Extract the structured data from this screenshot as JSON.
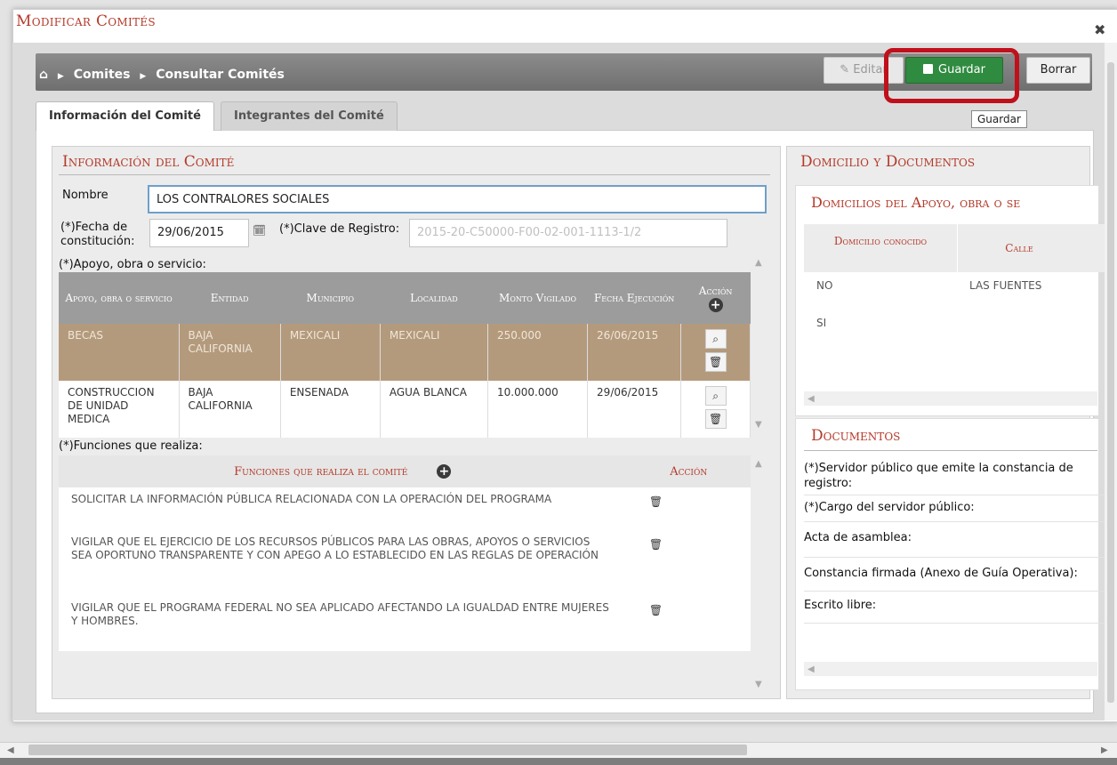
{
  "dialog": {
    "title": "Modificar Comités",
    "close_icon": "✖"
  },
  "breadcrumb": {
    "home_icon": "⌂",
    "items": [
      "Comites",
      "Consultar Comités"
    ]
  },
  "toolbar": {
    "editar": "Editar",
    "guardar": "Guardar",
    "borrar": "Borrar",
    "tooltip": "Guardar"
  },
  "tabs": [
    "Información del Comité",
    "Integrantes del Comité"
  ],
  "info": {
    "title": "Información del Comité",
    "nombre_label": "Nombre",
    "nombre_value": "LOS CONTRALORES SOCIALES",
    "fecha_label_1": "(*)Fecha de",
    "fecha_label_2": "constitución:",
    "fecha_value": "29/06/2015",
    "clave_label": "(*)Clave de Registro:",
    "clave_value": "2015-20-C50000-F00-02-001-1113-1/2",
    "apoyo_label": "(*)Apoyo, obra o servicio:",
    "funciones_label": "(*)Funciones que realiza:"
  },
  "apoyo_table": {
    "headers": [
      "Apoyo, obra o servicio",
      "Entidad",
      "Municipio",
      "Localidad",
      "Monto Vigilado",
      "Fecha Ejecución",
      "Acción"
    ],
    "rows": [
      [
        "BECAS",
        "BAJA CALIFORNIA",
        "MEXICALI",
        "MEXICALI",
        "250.000",
        "26/06/2015"
      ],
      [
        "CONSTRUCCION DE UNIDAD MEDICA",
        "BAJA CALIFORNIA",
        "ENSENADA",
        "AGUA BLANCA",
        "10.000.000",
        "29/06/2015"
      ]
    ]
  },
  "funciones_table": {
    "headers": [
      "Funciones que realiza el comité",
      "Acción"
    ],
    "rows": [
      "SOLICITAR LA INFORMACIÓN PÚBLICA RELACIONADA CON LA OPERACIÓN DEL PROGRAMA",
      "VIGILAR QUE EL EJERCICIO DE LOS RECURSOS PÚBLICOS PARA LAS OBRAS, APOYOS O SERVICIOS SEA OPORTUNO TRANSPARENTE Y CON APEGO A LO ESTABLECIDO EN LAS REGLAS DE OPERACIÓN",
      "VIGILAR QUE EL PROGRAMA FEDERAL NO SEA APLICADO AFECTANDO LA IGUALDAD ENTRE MUJERES Y HOMBRES."
    ]
  },
  "domicilio": {
    "title": "Domicilio y Documentos",
    "sub_title": "Domicilios del Apoyo, obra o se",
    "headers": [
      "Domicilio conocido",
      "Calle"
    ],
    "rows": [
      [
        "NO",
        "LAS FUENTES"
      ],
      [
        "SI",
        ""
      ]
    ]
  },
  "documentos": {
    "title": "Documentos",
    "items": [
      "(*)Servidor público que emite la constancia de registro:",
      "(*)Cargo del servidor público:",
      "Acta de asamblea:",
      "Constancia firmada (Anexo de Guía Operativa):",
      "Escrito libre:"
    ]
  },
  "colors": {
    "accent": "#b43a2a",
    "save_green": "#2f8b3f",
    "highlight_red": "#c0101c",
    "selected_row": "#b49a7c"
  }
}
